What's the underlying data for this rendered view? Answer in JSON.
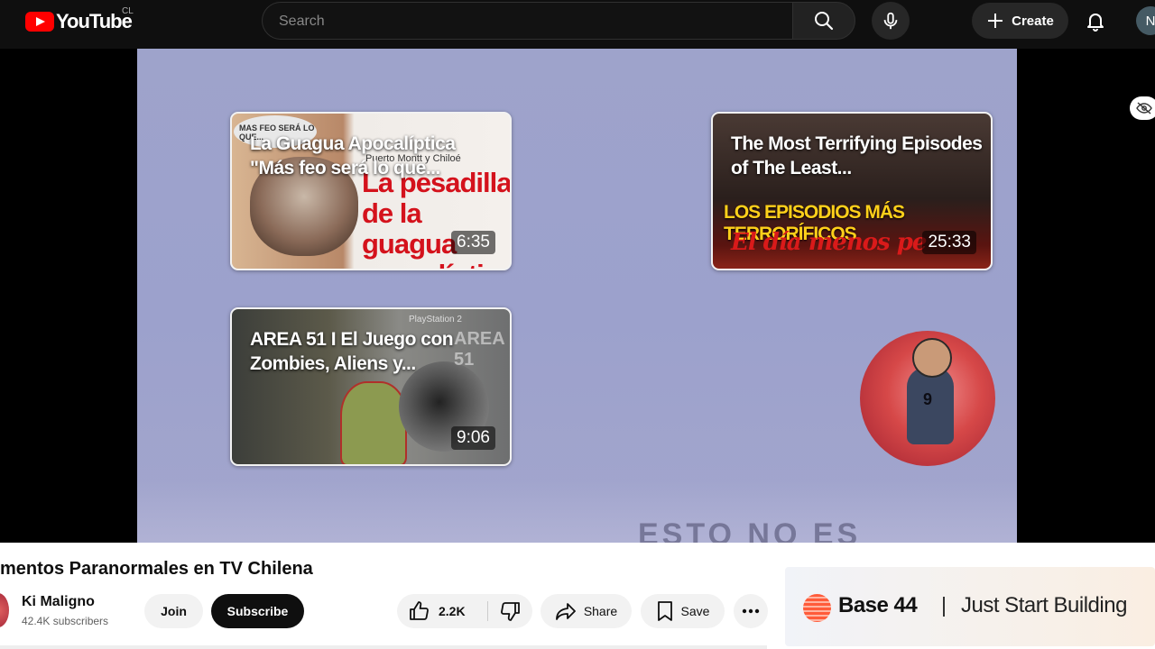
{
  "header": {
    "logo_text": "YouTube",
    "country_code": "CL",
    "search_placeholder": "Search",
    "create_label": "Create",
    "account_initial": "N"
  },
  "player": {
    "endcards": [
      {
        "title": "La Guagua Apocalíptica \"Más feo será lo que...",
        "duration": "6:35",
        "thumb_text": "La pesadilla de la guagua apocalíptica",
        "thumb_small": "Puerto Montt y Chiloé",
        "bubble": "MAS FEO SERÁ LO QUE..."
      },
      {
        "title": "The Most Terrifying Episodes of The Least...",
        "duration": "25:33",
        "thumb_text": "LOS EPISODIOS MÁS TERRORÍFICOS",
        "thumb_script": "El día menos pe"
      },
      {
        "title": "AREA 51 I El Juego con Zombies, Aliens y...",
        "duration": "9:06",
        "thumb_text": "PlayStation 2",
        "thumb_logo": "AREA 51"
      }
    ],
    "channel_avatar_number": "9",
    "ghost_text": "ESTO NO ES"
  },
  "below": {
    "video_title": "mentos Paranormales en TV Chilena",
    "channel_name": "Ki Maligno",
    "subscribers": "42.4K subscribers",
    "join_label": "Join",
    "subscribe_label": "Subscribe",
    "like_count": "2.2K",
    "share_label": "Share",
    "save_label": "Save"
  },
  "ad": {
    "brand": "Base 44",
    "separator": "|",
    "tagline": "Just Start Building"
  },
  "colors": {
    "youtube_red": "#ff0000",
    "topbar_bg": "#0f0f0f",
    "video_bg": "#9ea3cb",
    "subscribe_bg": "#0f0f0f"
  }
}
